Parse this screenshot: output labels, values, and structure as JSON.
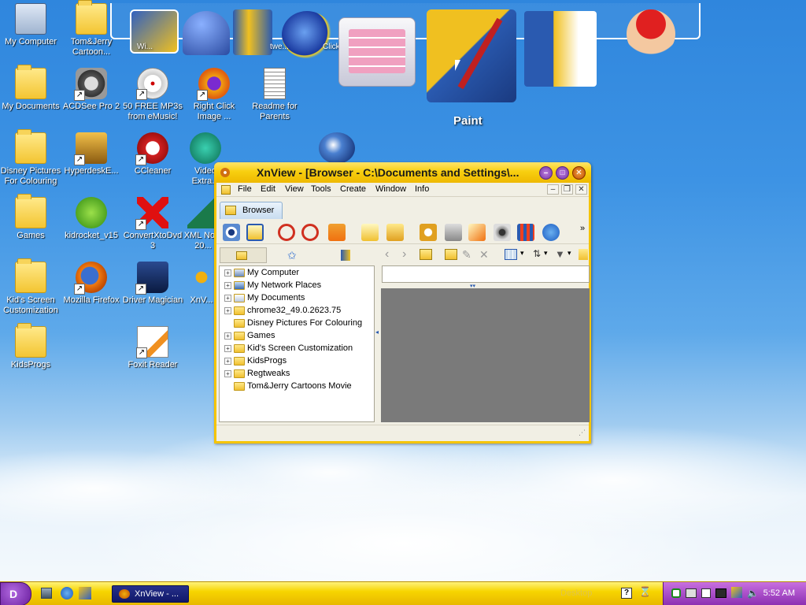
{
  "desktop": {
    "icons": [
      {
        "label": "My Computer"
      },
      {
        "label": "Tom&Jerry Cartoon..."
      },
      {
        "label": "My Documents"
      },
      {
        "label": "ACDSee Pro 2"
      },
      {
        "label": "50 FREE MP3s from eMusic!"
      },
      {
        "label": "Right Click Image ..."
      },
      {
        "label": "Readme for Parents"
      },
      {
        "label": "Disney Pictures For Colouring"
      },
      {
        "label": "HyperdeskE..."
      },
      {
        "label": "CCleaner"
      },
      {
        "label": "Video Extra..."
      },
      {
        "label": "Games"
      },
      {
        "label": "kidrocket_v15"
      },
      {
        "label": "ConvertXtoDvd 3"
      },
      {
        "label": "XML No... 20..."
      },
      {
        "label": "Kid's Screen Customization"
      },
      {
        "label": "Mozilla Firefox"
      },
      {
        "label": "Driver Magician"
      },
      {
        "label": "XnV..."
      },
      {
        "label": "KidsProgs"
      },
      {
        "label": "Foxit Reader"
      }
    ]
  },
  "dock": {
    "items": [
      {
        "label": "Wi..."
      },
      {
        "label": "twe..."
      },
      {
        "label": "ClickT... Play"
      },
      {
        "label": "Paint"
      }
    ]
  },
  "window": {
    "title": "XnView - [Browser - C:\\Documents and Settings\\...",
    "menu": [
      "File",
      "Edit",
      "View",
      "Tools",
      "Create",
      "Window",
      "Info"
    ],
    "tab_label": "Browser",
    "tree": [
      {
        "label": "My Computer",
        "expandable": true,
        "icon": "computer-icon"
      },
      {
        "label": "My Network Places",
        "expandable": true,
        "icon": "network-icon"
      },
      {
        "label": "My Documents",
        "expandable": true,
        "icon": "documents-icon"
      },
      {
        "label": "chrome32_49.0.2623.75",
        "expandable": true,
        "icon": "folder-icon"
      },
      {
        "label": "Disney Pictures For Colouring",
        "expandable": false,
        "icon": "folder-icon"
      },
      {
        "label": "Games",
        "expandable": true,
        "icon": "folder-icon"
      },
      {
        "label": "Kid's Screen Customization",
        "expandable": true,
        "icon": "folder-icon"
      },
      {
        "label": "KidsProgs",
        "expandable": true,
        "icon": "folder-icon"
      },
      {
        "label": "Regtweaks",
        "expandable": true,
        "icon": "folder-icon"
      },
      {
        "label": "Tom&Jerry Cartoons Movie",
        "expandable": false,
        "icon": "folder-icon"
      }
    ]
  },
  "taskbar": {
    "task_label": "XnView - ...",
    "desktop_label": "Desktop",
    "clock": "5:52 AM"
  },
  "colors": {
    "taskbar": "#f7d500",
    "titlebar": "#f8cf10",
    "tray": "#8a2db0",
    "start": "#6a1f9e"
  }
}
